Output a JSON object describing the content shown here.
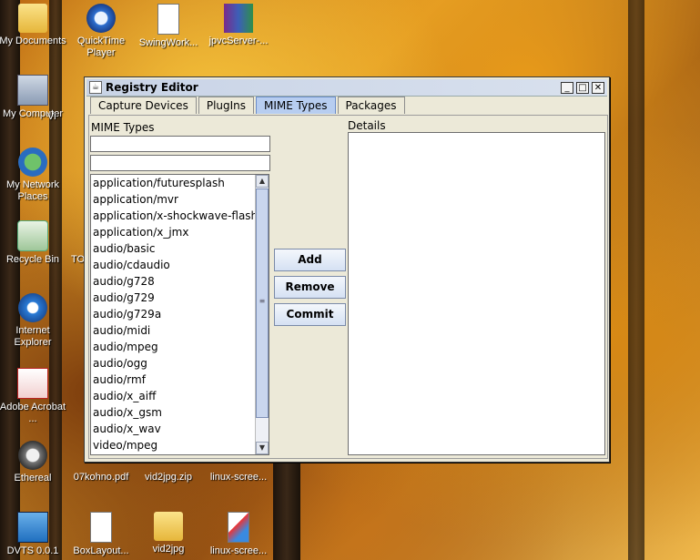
{
  "desktop": {
    "icons": [
      {
        "label": "My Documents"
      },
      {
        "label": "QuickTime Player"
      },
      {
        "label": "SwingWork..."
      },
      {
        "label": "jpvcServer-..."
      },
      {
        "label": "My Computer"
      },
      {
        "label": "Vi"
      },
      {
        "label": "My Network Places"
      },
      {
        "label": "Recycle Bin"
      },
      {
        "label": "TO"
      },
      {
        "label": "Internet Explorer"
      },
      {
        "label": "Adobe Acrobat ..."
      },
      {
        "label": "Ethereal"
      },
      {
        "label": "07kohno.pdf"
      },
      {
        "label": "vid2jpg.zip"
      },
      {
        "label": "linux-scree..."
      },
      {
        "label": "DVTS 0.0.1"
      },
      {
        "label": "BoxLayout..."
      },
      {
        "label": "vid2jpg"
      },
      {
        "label": "linux-scree..."
      }
    ]
  },
  "window": {
    "title": "Registry Editor",
    "minimize": "_",
    "maximize": "□",
    "close": "✕",
    "tabs": [
      {
        "label": "Capture Devices"
      },
      {
        "label": "PlugIns"
      },
      {
        "label": "MIME Types"
      },
      {
        "label": "Packages"
      }
    ],
    "active_tab": "MIME Types"
  },
  "mime": {
    "heading": "MIME Types",
    "field1_value": "",
    "field2_value": "",
    "items": [
      "application/futuresplash",
      "application/mvr",
      "application/x-shockwave-flash",
      "application/x_jmx",
      "audio/basic",
      "audio/cdaudio",
      "audio/g728",
      "audio/g729",
      "audio/g729a",
      "audio/midi",
      "audio/mpeg",
      "audio/ogg",
      "audio/rmf",
      "audio/x_aiff",
      "audio/x_gsm",
      "audio/x_wav",
      "video/mpeg"
    ]
  },
  "buttons": {
    "add": "Add",
    "remove": "Remove",
    "commit": "Commit"
  },
  "details": {
    "heading": "Details"
  }
}
